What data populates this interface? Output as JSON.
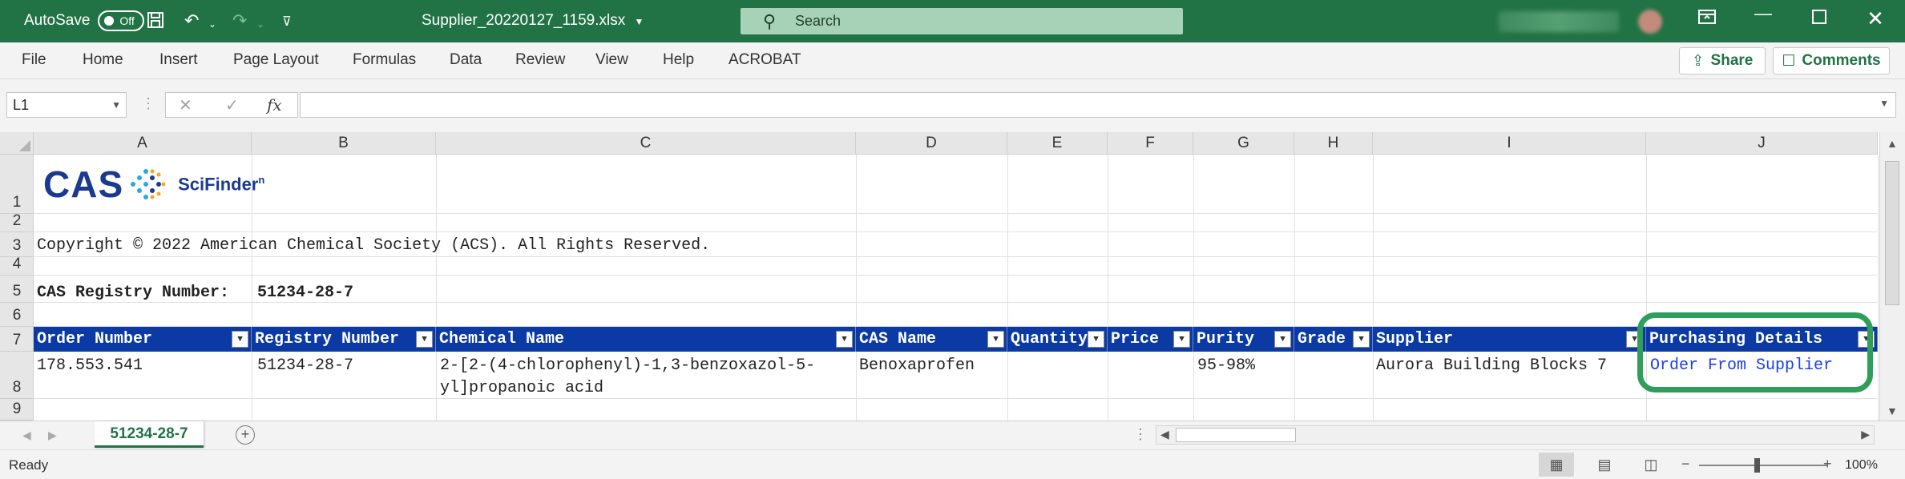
{
  "titlebar": {
    "autosave_label": "AutoSave",
    "autosave_state": "Off",
    "filename": "Supplier_20220127_1159.xlsx",
    "search_placeholder": "Search"
  },
  "ribbon": {
    "tabs": [
      "File",
      "Home",
      "Insert",
      "Page Layout",
      "Formulas",
      "Data",
      "Review",
      "View",
      "Help",
      "ACROBAT"
    ],
    "share_label": "Share",
    "comments_label": "Comments"
  },
  "formula_bar": {
    "name_box": "L1",
    "fx_label": "fx",
    "formula": ""
  },
  "grid": {
    "columns": [
      "A",
      "B",
      "C",
      "D",
      "E",
      "F",
      "G",
      "H",
      "I",
      "J"
    ],
    "rows": [
      "1",
      "2",
      "3",
      "4",
      "5",
      "6",
      "7",
      "8",
      "9"
    ],
    "logo": {
      "brand": "CAS",
      "product": "SciFinder",
      "product_sup": "n"
    },
    "copyright": "Copyright © 2022 American Chemical Society (ACS).  All Rights Reserved.",
    "registry_label": "CAS Registry Number:",
    "registry_value": "51234-28-7",
    "table_headers": [
      "Order Number",
      "Registry Number",
      "Chemical Name",
      "CAS Name",
      "Quantity",
      "Price",
      "Purity",
      "Grade",
      "Supplier",
      "Purchasing Details"
    ],
    "table_row": {
      "order_number": "178.553.541",
      "registry_number": "51234-28-7",
      "chemical_name_line1": "2-[2-(4-chlorophenyl)-1,3-benzoxazol-5-",
      "chemical_name_line2": "yl]propanoic acid",
      "cas_name": "Benoxaprofen",
      "quantity": "",
      "price": "",
      "purity": "95-98%",
      "grade": "",
      "supplier": "Aurora Building Blocks 7",
      "purchasing_link": "Order From Supplier"
    },
    "link_color": "#1a3cf0",
    "header_color": "#0b3aa5",
    "highlight_color": "#2f9e5b"
  },
  "sheets": {
    "active_sheet": "51234-28-7"
  },
  "statusbar": {
    "status": "Ready",
    "zoom": "100%"
  },
  "colors": {
    "excel_green": "#217346"
  }
}
